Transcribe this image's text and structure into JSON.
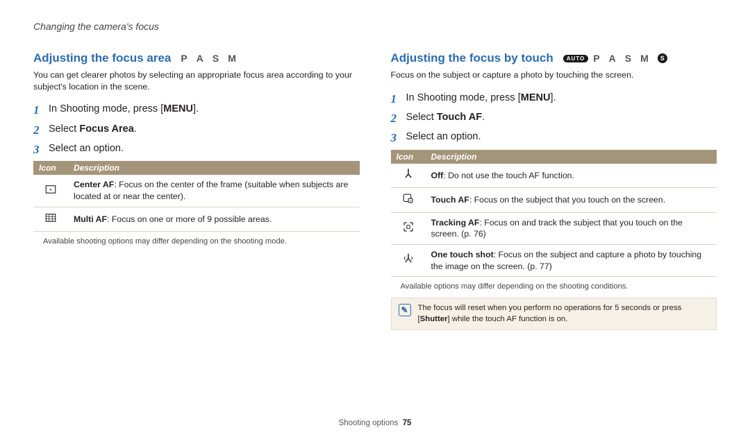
{
  "header": "Changing the camera's focus",
  "footer": {
    "section": "Shooting options",
    "page": "75"
  },
  "left": {
    "title": "Adjusting the focus area",
    "modes": [
      "P",
      "A",
      "S",
      "M"
    ],
    "intro": "You can get clearer photos by selecting an appropriate focus area according to your subject's location in the scene.",
    "steps": {
      "s1_pre": "In Shooting mode, press [",
      "s1_menu": "MENU",
      "s1_post": "].",
      "s2_pre": "Select ",
      "s2_bold": "Focus Area",
      "s2_post": ".",
      "s3": "Select an option."
    },
    "table": {
      "h_icon": "Icon",
      "h_desc": "Description",
      "rows": [
        {
          "icon": "center-af-icon",
          "bold": "Center AF",
          "text": ": Focus on the center of the frame (suitable when subjects are located at or near the center)."
        },
        {
          "icon": "multi-af-icon",
          "bold": "Multi AF",
          "text": ": Focus on one or more of 9 possible areas."
        }
      ]
    },
    "footnote": "Available shooting options may differ depending on the shooting mode."
  },
  "right": {
    "title": "Adjusting the focus by touch",
    "modes_pre_badge": "AUTO",
    "modes": [
      "P",
      "A",
      "S",
      "M"
    ],
    "modes_post_badge": "S",
    "intro": "Focus on the subject or capture a photo by touching the screen.",
    "steps": {
      "s1_pre": "In Shooting mode, press [",
      "s1_menu": "MENU",
      "s1_post": "].",
      "s2_pre": "Select ",
      "s2_bold": "Touch AF",
      "s2_post": ".",
      "s3": "Select an option."
    },
    "table": {
      "h_icon": "Icon",
      "h_desc": "Description",
      "rows": [
        {
          "icon": "off-icon",
          "bold": "Off",
          "text": ": Do not use the touch AF function."
        },
        {
          "icon": "touch-af-icon",
          "bold": "Touch AF",
          "text": ": Focus on the subject that you touch on the screen."
        },
        {
          "icon": "tracking-af-icon",
          "bold": "Tracking AF",
          "text": ": Focus on and track the subject that you touch on the screen. (p. 76)"
        },
        {
          "icon": "one-touch-shot-icon",
          "bold": "One touch shot",
          "text": ": Focus on the subject and capture a photo by touching the image on the screen. (p. 77)"
        }
      ]
    },
    "footnote": "Available options may differ depending on the shooting conditions.",
    "note_pre": "The focus will reset when you perform no operations for 5 seconds or press [",
    "note_bold": "Shutter",
    "note_post": "] while the touch AF function is on."
  }
}
